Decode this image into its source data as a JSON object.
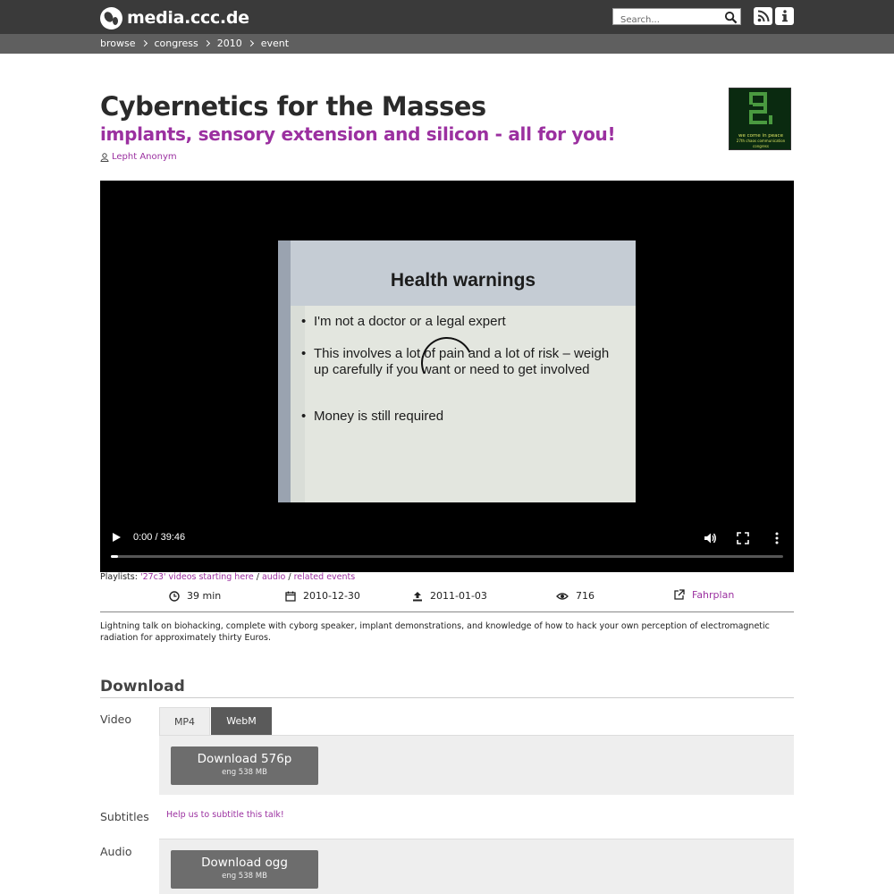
{
  "header": {
    "logo_text": "media.ccc.de",
    "search_placeholder": "Search...",
    "rss_label": "rss-icon",
    "info_label": "info-icon"
  },
  "breadcrumb": [
    "browse",
    "congress",
    "2010",
    "event"
  ],
  "event": {
    "title": "Cybernetics for the Masses",
    "subtitle": "implants, sensory extension and silicon - all for you!",
    "speaker": "Lepht Anonym",
    "thumbnail_text": "we come in peace",
    "thumbnail_subtext": "27th chaos communication congress"
  },
  "video": {
    "slide_title": "Health warnings",
    "slide_bullets": [
      "I'm not a doctor or a legal expert",
      "This involves a lot of pain and a lot of risk – weigh up carefully if you want or need to get involved",
      "Money is still required"
    ],
    "time": "0:00 / 39:46",
    "progress": 0.01
  },
  "playlists": {
    "label": "Playlists:",
    "items": [
      "'27c3' videos starting here",
      "audio",
      "related events"
    ],
    "sep": "/"
  },
  "meta": {
    "duration": "39 min",
    "date": "2010-12-30",
    "released": "2011-01-03",
    "views": "716",
    "fahrplan": "Fahrplan"
  },
  "description": "Lightning talk on biohacking, complete with cyborg speaker, implant demonstrations, and knowledge of how to hack your own perception of electromagnetic radiation for approximately thirty Euros.",
  "download": {
    "heading": "Download",
    "video_label": "Video",
    "tabs": [
      "MP4",
      "WebM"
    ],
    "video_button": {
      "main": "Download 576p",
      "sub": "eng 538 MB"
    },
    "subtitles_label": "Subtitles",
    "subtitles_link": "Help us to subtitle this talk!",
    "audio_label": "Audio",
    "audio_button": {
      "main": "Download ogg",
      "sub": "eng 538 MB"
    }
  },
  "colors": {
    "accent": "#9b30a0",
    "topbar": "#3a3a3a",
    "crumbbar": "#5f5f5f"
  }
}
